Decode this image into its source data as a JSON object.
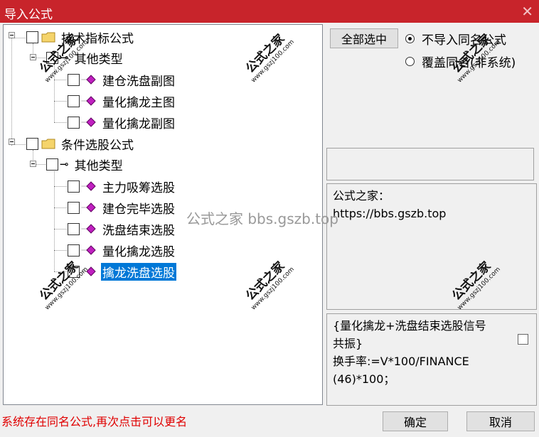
{
  "window": {
    "title": "导入公式",
    "close_glyph": "✕"
  },
  "tree": {
    "root1": {
      "label": "技术指标公式",
      "child": {
        "label": "其他类型",
        "items": [
          "建仓洗盘副图",
          "量化擒龙主图",
          "量化擒龙副图"
        ]
      }
    },
    "root2": {
      "label": "条件选股公式",
      "child": {
        "label": "其他类型",
        "items": [
          "主力吸筹选股",
          "建仓完毕选股",
          "洗盘结束选股",
          "量化擒龙选股",
          "擒龙洗盘选股"
        ]
      }
    }
  },
  "controls": {
    "select_all": "全部选中",
    "radio_no_import": "不导入同名公式",
    "radio_overwrite": "覆盖同名(非系统)",
    "selected_radio": "radio_no_import"
  },
  "info": {
    "line1": "公式之家：",
    "line2": "https://bbs.gszb.top"
  },
  "desc": {
    "lines": [
      "{量化擒龙+洗盘结束选股信号",
      "共振}",
      "换手率:=V*100/FINANCE",
      "(46)*100；"
    ]
  },
  "status_text": "系统存在同名公式,再次点击可以更名",
  "buttons": {
    "ok": "确定",
    "cancel": "取消"
  },
  "watermark": {
    "main": "公式之家",
    "url": "www.gszj100.com",
    "center": "公式之家 bbs.gszb.top"
  }
}
